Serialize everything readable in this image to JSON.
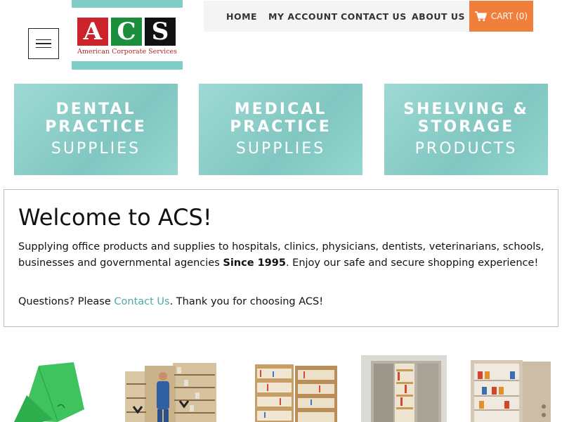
{
  "header": {
    "logo_text": [
      "A",
      "C",
      "S"
    ],
    "logo_tagline": "American Corporate Services"
  },
  "nav": {
    "home": "HOME",
    "my_account": "MY ACCOUNT",
    "contact_us": "CONTACT US",
    "about_us": "ABOUT US",
    "cart": "CART (0)"
  },
  "categories": [
    {
      "line1": "DENTAL",
      "line2": "PRACTICE",
      "sub": "SUPPLIES"
    },
    {
      "line1": "MEDICAL",
      "line2": "PRACTICE",
      "sub": "SUPPLIES"
    },
    {
      "line1": "SHELVING &",
      "line2": "STORAGE",
      "sub": "PRODUCTS"
    }
  ],
  "welcome": {
    "title": "Welcome to ACS!",
    "intro": "Supplying office products and supplies to hospitals, clinics, physicians, dentists, veterinarians, schools, businesses and governmental agencies ",
    "since": "Since 1995",
    "intro_end": ". Enjoy our safe and secure shopping experience!",
    "questions_pre": "Questions? Please ",
    "contact_link": "Contact Us",
    "questions_post": ". Thank you for choosing ACS!"
  },
  "colors": {
    "teal": "#7fcdc6",
    "cart_orange": "#f07f3c",
    "link": "#4eaaa3",
    "logo_red": "#cc2229",
    "logo_green": "#1b8e3c"
  }
}
